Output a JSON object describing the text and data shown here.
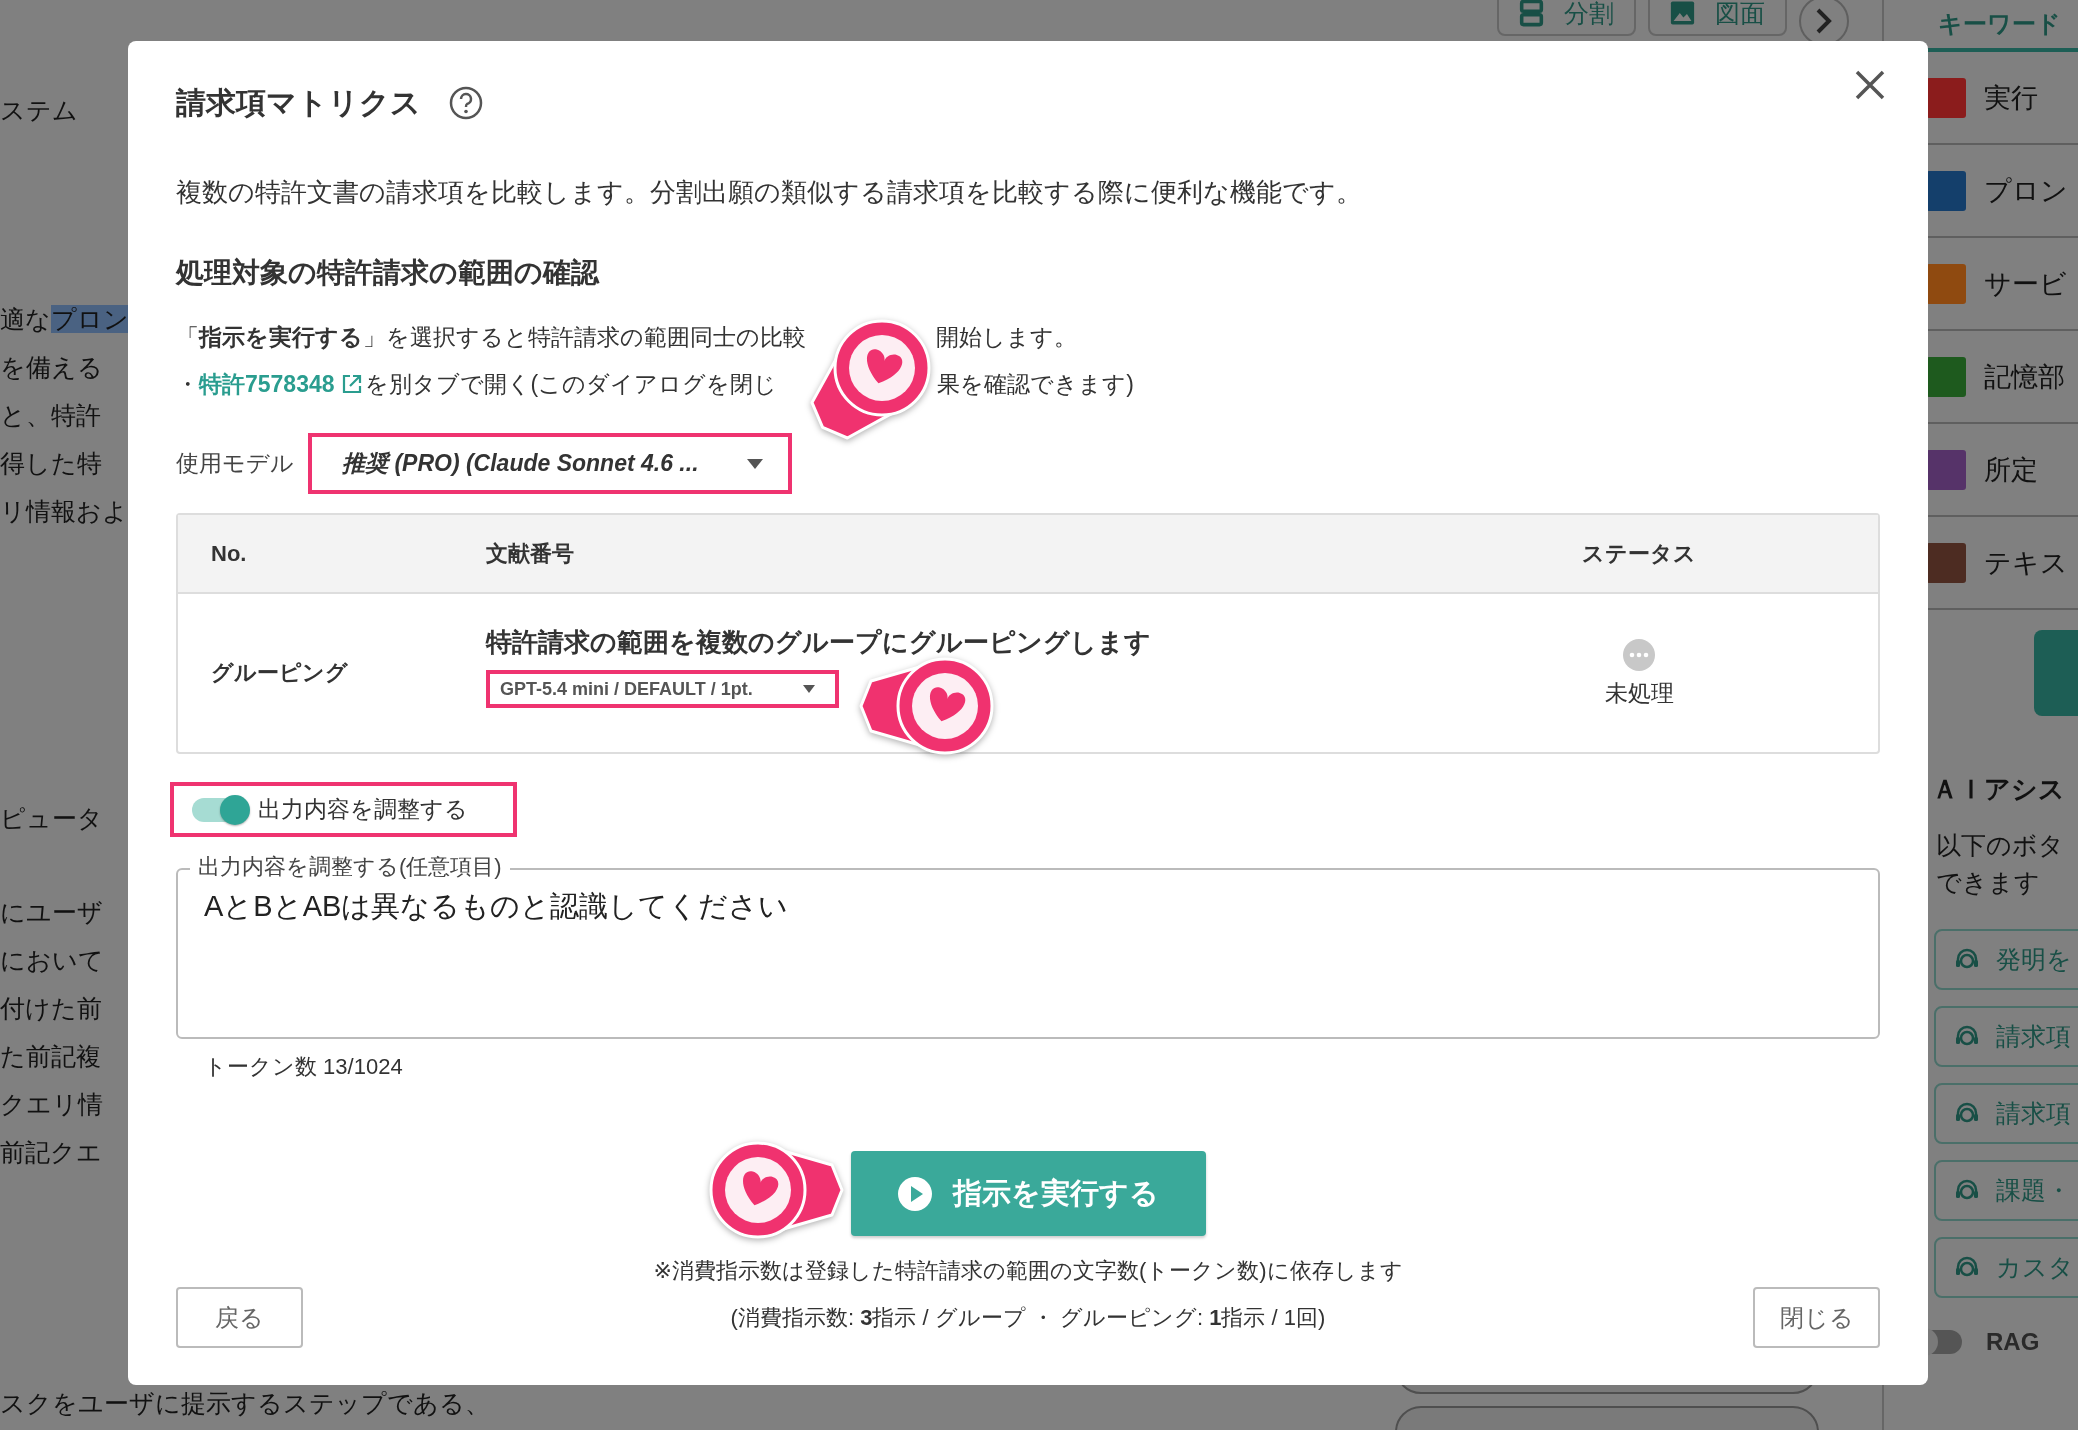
{
  "background_page": {
    "toolbar": [
      {
        "kind": "split",
        "label": "分割"
      },
      {
        "kind": "figure",
        "label": "図面"
      },
      {
        "kind": "next"
      }
    ],
    "document_paragraphs": [
      [
        {
          "text": "ステム"
        }
      ],
      [
        {
          "text": "適な",
          "highlighted": "プロン"
        },
        {
          "text": "を備える"
        },
        {
          "text": "と、特許"
        },
        {
          "text": "得した特"
        },
        {
          "text": "リ情報およ"
        }
      ],
      [
        {
          "text": "ピュータ"
        }
      ],
      [
        {
          "text": "にユーザ"
        },
        {
          "text": "において"
        },
        {
          "text": "付けた前"
        },
        {
          "text": "た前記複"
        },
        {
          "text": "クエリ情"
        },
        {
          "text": "前記クエ"
        }
      ],
      [
        {
          "text": "スクをユーザに提示するステップである、"
        }
      ]
    ],
    "sidebar": {
      "tab": "キーワード",
      "keywords": [
        {
          "label": "実行",
          "color": "#8b1c1c"
        },
        {
          "label": "プロン",
          "color": "#143f6b"
        },
        {
          "label": "サービ",
          "color": "#8f4a10"
        },
        {
          "label": "記憶部",
          "color": "#1e5a1e"
        },
        {
          "label": "所定",
          "color": "#563369"
        },
        {
          "label": "テキス",
          "color": "#4d2c22"
        }
      ],
      "ai_heading": "ＡＩアシス",
      "ai_description": [
        "以下のボタ",
        "できます"
      ],
      "ai_buttons": [
        "発明を",
        "請求項",
        "請求項",
        "課題・",
        "カスタ"
      ],
      "rag_toggle": {
        "label": "RAG",
        "on": false
      }
    }
  },
  "dialog": {
    "title": "請求項マトリクス",
    "description": "複数の特許文書の請求項を比較します。分割出願の類似する請求項を比較する際に便利な機能です。",
    "section_title": "処理対象の特許請求の範囲の確認",
    "instruction": {
      "before": "「**指示を実行する**」を選択すると特許請求の範囲同士の比較",
      "after": "開始します。"
    },
    "link_line": {
      "bullet": "・",
      "link": "特許7578348",
      "before": "を別タブで開く(このダイアログを閉じ",
      "after": "果を確認できます)"
    },
    "model": {
      "label": "使用モデル",
      "value": "推奨 (PRO) (Claude Sonnet 4.6 ...",
      "highlighted": true
    },
    "table": {
      "columns": [
        "No.",
        "文献番号",
        "ステータス"
      ],
      "rows": [
        {
          "no": "グルーピング",
          "title": "特許請求の範囲を複数のグループにグルーピングします",
          "model": "GPT-5.4 mini / DEFAULT / 1pt.",
          "model_highlighted": true,
          "status": "未処理"
        }
      ]
    },
    "adjust_toggle": {
      "label": "出力内容を調整する",
      "on": true,
      "highlighted": true
    },
    "adjust_field": {
      "legend": "出力内容を調整する(任意項目)",
      "value": "AとBとABは異なるものと認識してください",
      "token_count": "トークン数 13/1024"
    },
    "run_button": "指示を実行する",
    "notes": [
      "※消費指示数は登録した特許請求の範囲の文字数(トークン数)に依存します",
      "(消費指示数: **3**指示 / グループ ・ グルーピング: **1**指示 / 1回)"
    ],
    "back_button": "戻る",
    "close_button": "閉じる",
    "markers": [
      {
        "kind": "heart"
      },
      {
        "kind": "heart"
      },
      {
        "kind": "heart"
      }
    ]
  }
}
